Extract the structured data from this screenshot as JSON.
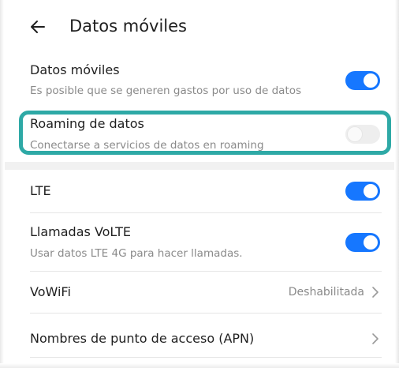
{
  "header": {
    "title": "Datos móviles"
  },
  "settings": {
    "mobile_data": {
      "title": "Datos móviles",
      "subtitle": "Es posible que se generen gastos por uso de datos",
      "enabled": true
    },
    "roaming": {
      "title": "Roaming de datos",
      "subtitle": "Conectarse a servicios de datos en roaming",
      "enabled": false
    },
    "lte": {
      "title": "LTE",
      "enabled": true
    },
    "volte": {
      "title": "Llamadas VoLTE",
      "subtitle": "Usar datos LTE 4G para hacer llamadas.",
      "enabled": true
    },
    "vowifi": {
      "title": "VoWiFi",
      "value": "Deshabilitada"
    },
    "apn": {
      "title": "Nombres de punto de acceso (APN)"
    }
  },
  "colors": {
    "accent": "#1677ff",
    "highlight": "#2ea9a6",
    "text_secondary": "#8a8a8a"
  },
  "icons": {
    "back": "arrow-left-icon",
    "chevron": "chevron-right-icon"
  }
}
